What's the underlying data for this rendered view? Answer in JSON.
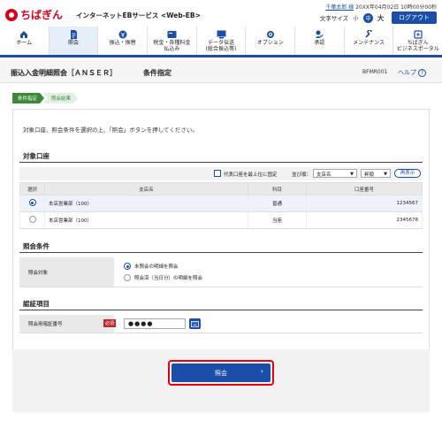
{
  "header": {
    "brand": "ちばぎん",
    "service": "インターネットEBサービス <Web-EB>",
    "user_name": "千葉太郎 様",
    "last_login": "20XX年04月02日 10時00分00秒",
    "font_size_label": "文字サイズ",
    "font_small": "小",
    "font_mid": "中",
    "font_large": "大",
    "logout": "ログアウト"
  },
  "nav": {
    "items": [
      {
        "label": "ホーム",
        "icon": "home-icon"
      },
      {
        "label": "照会",
        "icon": "document-icon"
      },
      {
        "label": "振込・振替",
        "icon": "transfer-icon"
      },
      {
        "label": "税金・各種料金\n払込み",
        "icon": "tax-icon"
      },
      {
        "label": "データ伝送\n(総合振込等)",
        "icon": "data-transfer-icon"
      },
      {
        "label": "オプション",
        "icon": "option-icon"
      },
      {
        "label": "承認",
        "icon": "approve-icon"
      },
      {
        "label": "メンテナンス",
        "icon": "maintenance-icon"
      },
      {
        "label": "ちばぎん\nビジネスポータル",
        "icon": "portal-icon"
      }
    ],
    "active_index": 1
  },
  "page": {
    "title": "振込入金明細照会［ＡＮＳＥＲ］",
    "subtitle": "条件指定",
    "screen_code": "BFMR001",
    "help": "ヘルプ"
  },
  "steps": [
    "条件指定",
    "照会結果"
  ],
  "instruction": "対象口座、照会条件を選択の上、「照会」ボタンを押してください。",
  "account_section": {
    "title": "対象口座",
    "pin_label": "代表口座を最上位に固定",
    "sort_label": "並び順：",
    "sort_field": "支店名",
    "sort_order": "昇順",
    "show_button": "再表示",
    "columns": [
      "選択",
      "支店名",
      "科目",
      "口座番号"
    ],
    "rows": [
      {
        "branch": "本店営業部（100）",
        "type": "普通",
        "number": "1234567",
        "selected": true
      },
      {
        "branch": "本店営業部（100）",
        "type": "当座",
        "number": "2345678",
        "selected": false
      }
    ]
  },
  "query_section": {
    "title": "照会条件",
    "label": "照会対象",
    "options": [
      {
        "label": "未照会の明細を照会",
        "selected": true
      },
      {
        "label": "照会済（当日分）の明細を照会",
        "selected": false
      }
    ]
  },
  "auth_section": {
    "title": "認証項目",
    "label": "照会用暗証番号",
    "required": "必須",
    "password_mask": "●●●●"
  },
  "submit_label": "照会",
  "colors": {
    "primary": "#1a4ea8",
    "brand_red": "#d9001b",
    "step_green": "#3a8a3a",
    "highlight": "#e60012"
  }
}
